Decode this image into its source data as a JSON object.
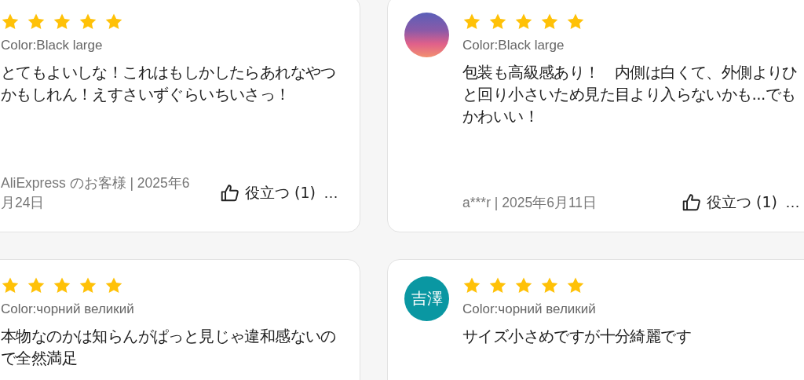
{
  "reviews": [
    {
      "stars": 5,
      "variant": "Color:Black large",
      "text": "とてもよいしな！これはもしかしたらあれなやつかもしれん！えすさいずぐらいちいさっ！",
      "author_date": "AliExpress のお客様 | 2025年6月24日",
      "helpful": "役立つ (1)",
      "more": "…"
    },
    {
      "avatar": {
        "kind": "photo"
      },
      "stars": 5,
      "variant": "Color:Black large",
      "text": "包装も高級感あり！　内側は白くて、外側よりひと回り小さいため見た目より入らないかも...でもかわいい！",
      "author_date": "a***r | 2025年6月11日",
      "helpful": "役立つ (1)",
      "more": "…"
    },
    {
      "stars": 5,
      "variant": "Color:чорний великий",
      "text": "本物なのかは知らんがぱっと見じゃ違和感ないので全然満足"
    },
    {
      "avatar": {
        "kind": "initials",
        "text": "吉澤"
      },
      "stars": 5,
      "variant": "Color:чорний великий",
      "text": "サイズ小さめですが十分綺麗です"
    }
  ]
}
